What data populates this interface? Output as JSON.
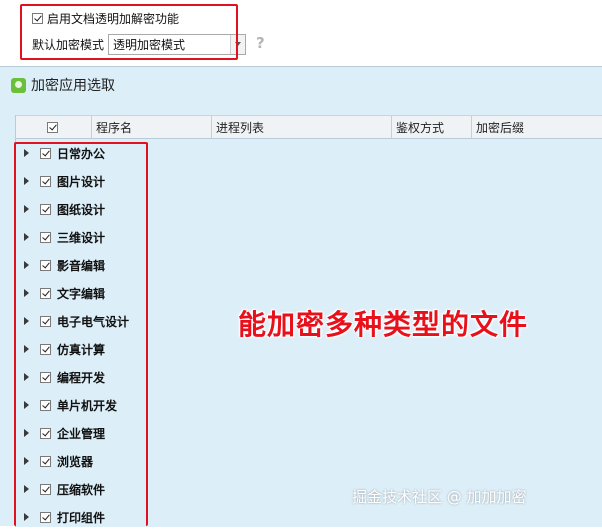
{
  "settings": {
    "enable_label": "启用文档透明加解密功能",
    "enable_checked": true,
    "mode_label": "默认加密模式",
    "mode_value": "透明加密模式",
    "help_glyph": "?"
  },
  "dialog": {
    "title": "加密应用选取",
    "columns": [
      "程序名",
      "进程列表",
      "鉴权方式",
      "加密后缀"
    ],
    "header_checked": true,
    "rows": [
      {
        "label": "日常办公",
        "checked": true
      },
      {
        "label": "图片设计",
        "checked": true
      },
      {
        "label": "图纸设计",
        "checked": true
      },
      {
        "label": "三维设计",
        "checked": true
      },
      {
        "label": "影音编辑",
        "checked": true
      },
      {
        "label": "文字编辑",
        "checked": true
      },
      {
        "label": "电子电气设计",
        "checked": true
      },
      {
        "label": "仿真计算",
        "checked": true
      },
      {
        "label": "编程开发",
        "checked": true
      },
      {
        "label": "单片机开发",
        "checked": true
      },
      {
        "label": "企业管理",
        "checked": true
      },
      {
        "label": "浏览器",
        "checked": true
      },
      {
        "label": "压缩软件",
        "checked": true
      },
      {
        "label": "打印组件",
        "checked": true
      }
    ]
  },
  "overlay": {
    "caption": "能加密多种类型的文件",
    "watermark": "掘金技术社区 @ 加加加密"
  },
  "colors": {
    "highlight_red": "#e0121f",
    "grid_background": "#dceef8",
    "caption_red": "#e8101b"
  }
}
